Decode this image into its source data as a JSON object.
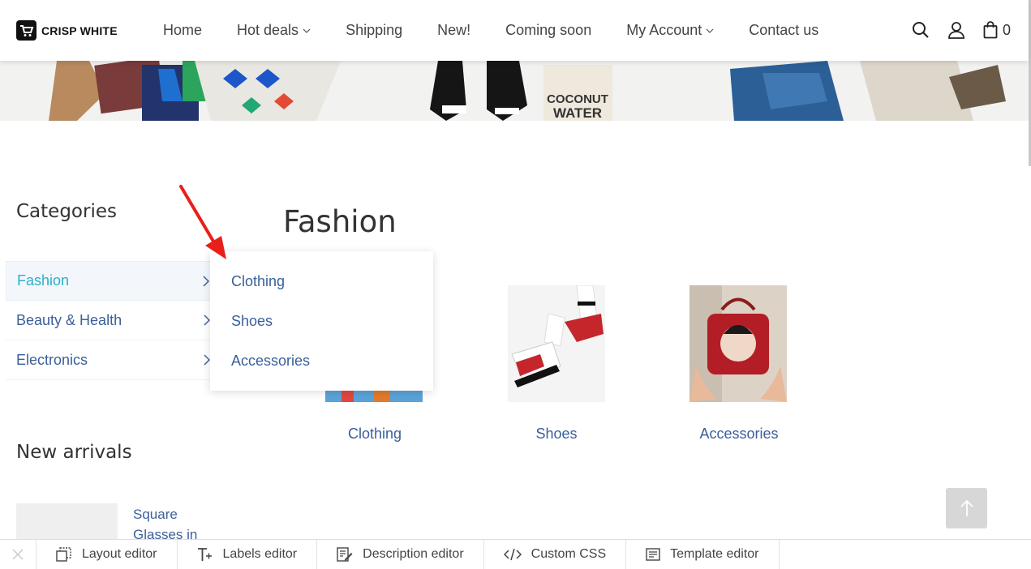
{
  "brand": {
    "name": "CRISP WHITE",
    "icon": "cart-logo-icon"
  },
  "nav": {
    "items": [
      {
        "label": "Home",
        "has_dropdown": false
      },
      {
        "label": "Hot deals",
        "has_dropdown": true
      },
      {
        "label": "Shipping",
        "has_dropdown": false
      },
      {
        "label": "New!",
        "has_dropdown": false
      },
      {
        "label": "Coming soon",
        "has_dropdown": false
      },
      {
        "label": "My Account",
        "has_dropdown": true
      },
      {
        "label": "Contact us",
        "has_dropdown": false
      }
    ],
    "cart_count": "0"
  },
  "banner": {
    "text_line1": "COCONUT",
    "text_line2": "WATER"
  },
  "sidebar": {
    "categories_title": "Categories",
    "categories": [
      {
        "label": "Fashion",
        "active": true
      },
      {
        "label": "Beauty & Health",
        "active": false
      },
      {
        "label": "Electronics",
        "active": false
      }
    ],
    "new_arrivals_title": "New arrivals",
    "new_arrival_item": "Square Glasses in"
  },
  "main": {
    "title": "Fashion",
    "products": [
      {
        "label": "Clothing"
      },
      {
        "label": "Shoes"
      },
      {
        "label": "Accessories"
      }
    ]
  },
  "dropdown": {
    "items": [
      "Clothing",
      "Shoes",
      "Accessories"
    ]
  },
  "toolbar": {
    "items": [
      {
        "label": "Layout editor",
        "icon": "layout-icon"
      },
      {
        "label": "Labels editor",
        "icon": "text-plus-icon"
      },
      {
        "label": "Description editor",
        "icon": "document-edit-icon"
      },
      {
        "label": "Custom CSS",
        "icon": "code-icon"
      },
      {
        "label": "Template editor",
        "icon": "template-icon"
      }
    ]
  },
  "colors": {
    "link": "#3a5f9a",
    "active": "#2ab0c9",
    "annotation": "#e8201a"
  }
}
